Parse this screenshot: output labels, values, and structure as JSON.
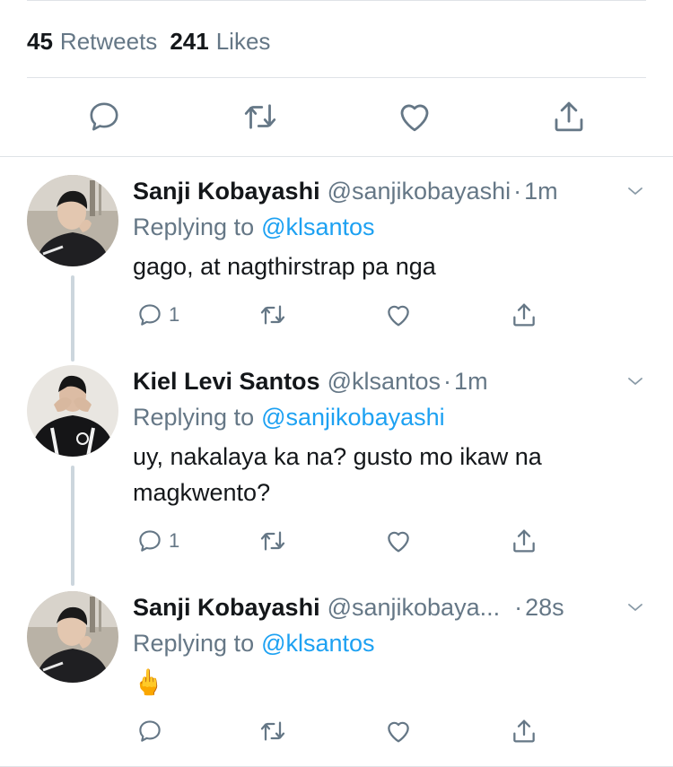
{
  "stats": {
    "retweets_count": "45",
    "retweets_label": "Retweets",
    "likes_count": "241",
    "likes_label": "Likes"
  },
  "colors": {
    "link": "#1da1f2",
    "secondary": "#657786",
    "primary_text": "#14171a",
    "divider": "#dfe3e7"
  },
  "main_actions": {
    "icons": [
      "reply-icon",
      "retweet-icon",
      "like-icon",
      "share-icon"
    ]
  },
  "replies": [
    {
      "name": "Sanji Kobayashi",
      "handle": "@sanjikobayashi",
      "time": "1m",
      "replying_label": "Replying to",
      "replying_to": "@klsantos",
      "text": "gago, at nagthirstrap pa nga",
      "reply_count": "1"
    },
    {
      "name": "Kiel Levi Santos",
      "handle": "@klsantos",
      "time": "1m",
      "replying_label": "Replying to",
      "replying_to": "@sanjikobayashi",
      "text": "uy, nakalaya ka na? gusto mo ikaw na magkwento?",
      "reply_count": "1"
    },
    {
      "name": "Sanji Kobayashi",
      "handle": "@sanjikobaya...",
      "time": "28s",
      "replying_label": "Replying to",
      "replying_to": "@klsantos",
      "text": "🖕",
      "reply_count": ""
    }
  ]
}
